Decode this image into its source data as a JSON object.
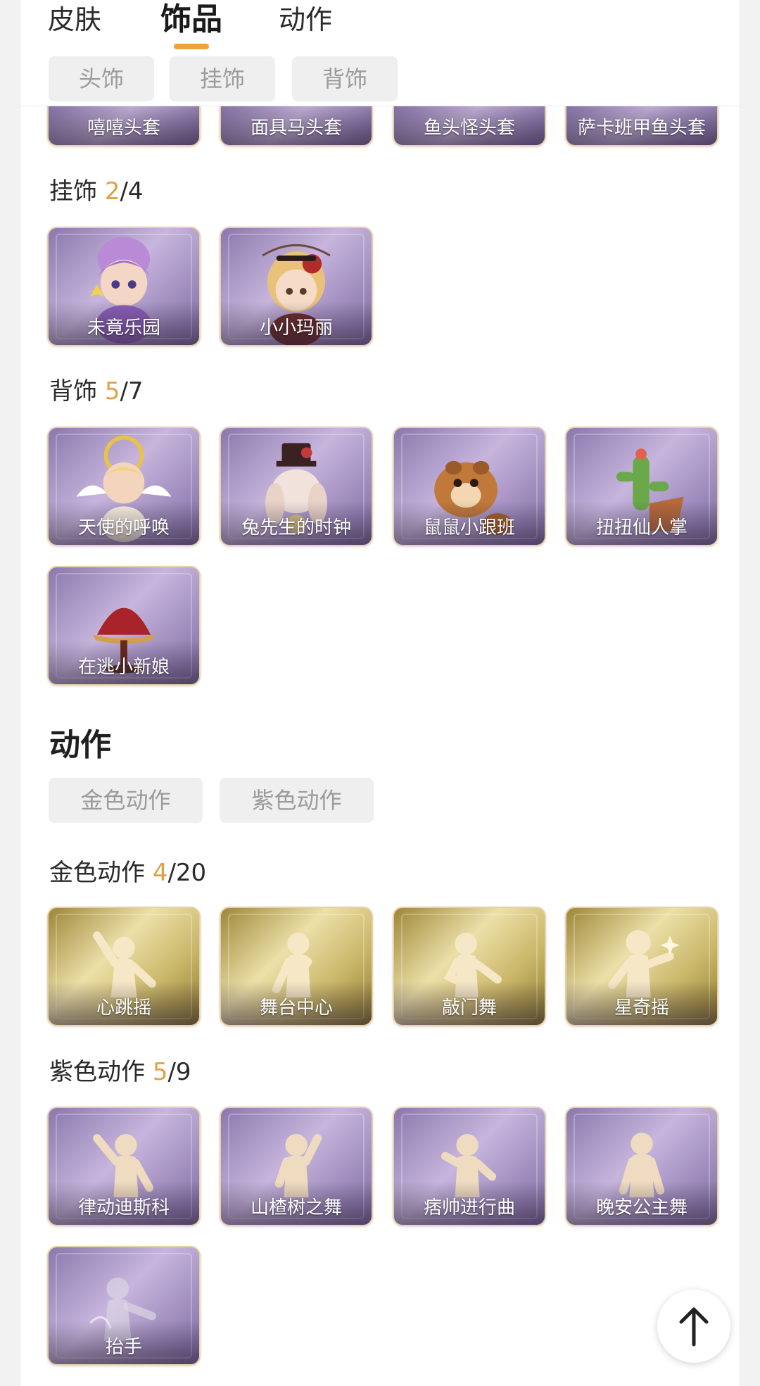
{
  "tabs": [
    "皮肤",
    "饰品",
    "动作"
  ],
  "accessory_filters": [
    "头饰",
    "挂饰",
    "背饰"
  ],
  "head_items": [
    "嘻嘻头套",
    "面具马头套",
    "鱼头怪头套",
    "萨卡班甲鱼头套"
  ],
  "hanging": {
    "title": "挂饰",
    "owned": "2",
    "total": "/4",
    "items": [
      "未竟乐园",
      "小小玛丽"
    ]
  },
  "back": {
    "title": "背饰",
    "owned": "5",
    "total": "/7",
    "items": [
      "天使的呼唤",
      "兔先生的时钟",
      "鼠鼠小跟班",
      "扭扭仙人掌",
      "在逃小新娘"
    ]
  },
  "actions": {
    "title": "动作",
    "filters": [
      "金色动作",
      "紫色动作"
    ]
  },
  "gold_actions": {
    "title": "金色动作",
    "owned": "4",
    "total": "/20",
    "items": [
      "心跳摇",
      "舞台中心",
      "敲门舞",
      "星奇摇"
    ]
  },
  "purple_actions": {
    "title": "紫色动作",
    "owned": "5",
    "total": "/9",
    "items": [
      "律动迪斯科",
      "山楂树之舞",
      "痞帅进行曲",
      "晚安公主舞",
      "抬手"
    ]
  },
  "colors": {
    "accent": "#f1a23a",
    "count": "#e0a04a",
    "purple_card": "#8a78ad",
    "gold_card": "#c9b668"
  },
  "icons": {
    "back_to_top": "arrow-up-icon"
  }
}
